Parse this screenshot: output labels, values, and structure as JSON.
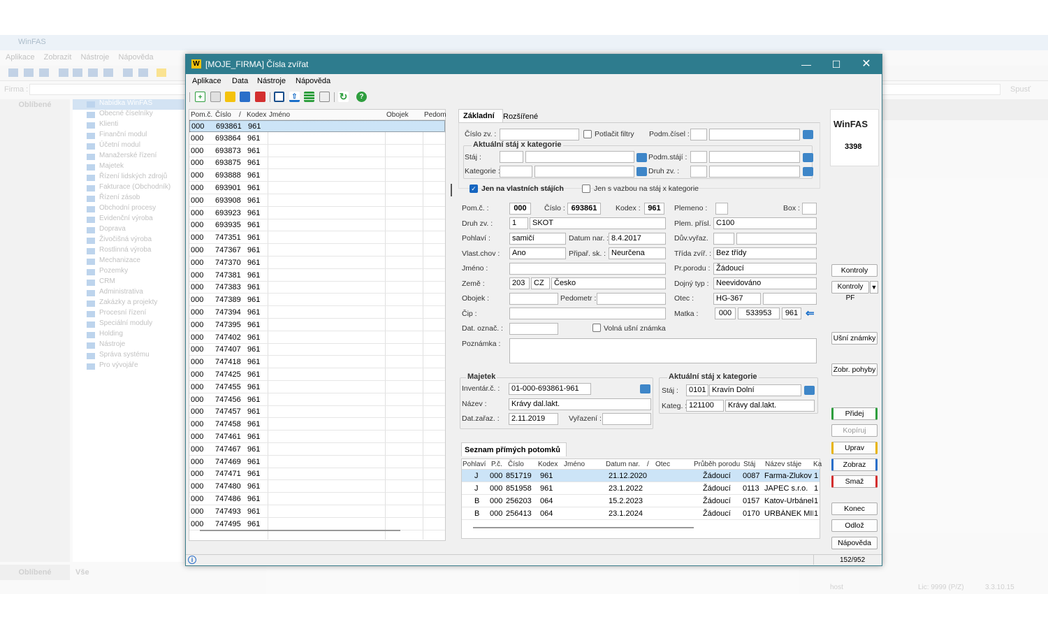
{
  "bg": {
    "title": "WinFAS",
    "menu": [
      "Aplikace",
      "Zobrazit",
      "Nástroje",
      "Nápověda"
    ],
    "firma_label": "Firma :",
    "left_header": "Oblíbené",
    "tree": [
      "Nabídka WinFAS",
      "Obecné číselníky",
      "Klienti",
      "Finanční modul",
      "Účetní modul",
      "Manažerské řízení",
      "Majetek",
      "Řízení lidských zdrojů",
      "Fakturace (Obchodník)",
      "Řízení zásob",
      "Obchodní procesy",
      "Evidenční výroba",
      "Doprava",
      "Živočišná výroba",
      "Rostlinná výroba",
      "Mechanizace",
      "Pozemky",
      "CRM",
      "Administrativa",
      "Zakázky a projekty",
      "Procesní řízení",
      "Speciální moduly",
      "Holding",
      "Nástroje",
      "Správa systému",
      "Pro vývojáře"
    ],
    "spust": "Spusť",
    "bottom_left": "Oblíbené",
    "bottom_all": "Vše",
    "status_host": "host",
    "status_lic": "Lic: 9999 (P/Z)",
    "status_ver": "3.3.10.15"
  },
  "window": {
    "title": "[MOJE_FIRMA] Čísla zvířat",
    "menu": [
      "Aplikace",
      "Data",
      "Nástroje",
      "Nápověda"
    ],
    "status_count": "152/952"
  },
  "list": {
    "headers": [
      "Pom.č.",
      "Číslo",
      "/",
      "Kodex",
      "Jméno",
      "Obojek",
      "Pedom"
    ],
    "rows": [
      [
        "000",
        "693861",
        "961"
      ],
      [
        "000",
        "693864",
        "961"
      ],
      [
        "000",
        "693873",
        "961"
      ],
      [
        "000",
        "693875",
        "961"
      ],
      [
        "000",
        "693888",
        "961"
      ],
      [
        "000",
        "693901",
        "961"
      ],
      [
        "000",
        "693908",
        "961"
      ],
      [
        "000",
        "693923",
        "961"
      ],
      [
        "000",
        "693935",
        "961"
      ],
      [
        "000",
        "747351",
        "961"
      ],
      [
        "000",
        "747367",
        "961"
      ],
      [
        "000",
        "747370",
        "961"
      ],
      [
        "000",
        "747381",
        "961"
      ],
      [
        "000",
        "747383",
        "961"
      ],
      [
        "000",
        "747389",
        "961"
      ],
      [
        "000",
        "747394",
        "961"
      ],
      [
        "000",
        "747395",
        "961"
      ],
      [
        "000",
        "747402",
        "961"
      ],
      [
        "000",
        "747407",
        "961"
      ],
      [
        "000",
        "747418",
        "961"
      ],
      [
        "000",
        "747425",
        "961"
      ],
      [
        "000",
        "747455",
        "961"
      ],
      [
        "000",
        "747456",
        "961"
      ],
      [
        "000",
        "747457",
        "961"
      ],
      [
        "000",
        "747458",
        "961"
      ],
      [
        "000",
        "747461",
        "961"
      ],
      [
        "000",
        "747467",
        "961"
      ],
      [
        "000",
        "747469",
        "961"
      ],
      [
        "000",
        "747471",
        "961"
      ],
      [
        "000",
        "747480",
        "961"
      ],
      [
        "000",
        "747486",
        "961"
      ],
      [
        "000",
        "747493",
        "961"
      ],
      [
        "000",
        "747495",
        "961"
      ]
    ]
  },
  "tabs": [
    "Základní",
    "Rozšířené"
  ],
  "filter": {
    "cislo_zv": "Číslo zv. :",
    "potlacit": "Potlačit filtry",
    "podm_cisel": "Podm.čísel :",
    "group_title": "Aktuální stáj x kategorie",
    "staj": "Stáj :",
    "podm_staji": "Podm.stájí :",
    "kategorie": "Kategorie :",
    "druh_zv": "Druh zv. :",
    "jen_vlastni": "Jen na vlastních stájích",
    "jen_vazbou": "Jen s vazbou na stáj x kategorie"
  },
  "form": {
    "pomc_l": "Pom.č. :",
    "pomc": "000",
    "cislo_l": "Číslo :",
    "cislo": "693861",
    "kodex_l": "Kodex :",
    "kodex": "961",
    "plemeno_l": "Plemeno :",
    "box_l": "Box :",
    "druh_l": "Druh zv. :",
    "druh_code": "1",
    "druh": "SKOT",
    "plem_prisl_l": "Plem. přísl. :",
    "plem_prisl": "C100",
    "pohlavi_l": "Pohlaví :",
    "pohlavi": "samičí",
    "datum_nar_l": "Datum nar. :",
    "datum_nar": "8.4.2017",
    "duv_vyraz_l": "Dův.vyřaz.",
    "vlast_chov_l": "Vlast.chov :",
    "vlast_chov": "Ano",
    "pripar_l": "Připař. sk. :",
    "pripar": "Neurčena",
    "trida_l": "Třída zvíř. :",
    "trida": "Bez třídy",
    "jmeno_l": "Jméno :",
    "pr_porodu_l": "Pr.porodu :",
    "pr_porodu": "Žádoucí",
    "zeme_l": "Země :",
    "zeme_code": "203",
    "zeme_iso": "CZ",
    "zeme": "Česko",
    "dojny_l": "Dojný typ :",
    "dojny": "Neevidováno",
    "obojek_l": "Obojek :",
    "pedometr_l": "Pedometr :",
    "otec_l": "Otec :",
    "otec": "HG-367",
    "cip_l": "Čip :",
    "matka_l": "Matka :",
    "matka_pom": "000",
    "matka_cislo": "533953",
    "matka_kodex": "961",
    "dat_ozn_l": "Dat. označ. :",
    "volna_l": "Volná ušní známka",
    "poznamka_l": "Poznámka :"
  },
  "majetek": {
    "title": "Majetek",
    "inv_l": "Inventár.č. :",
    "inv": "01-000-693861-961",
    "nazev_l": "Název :",
    "nazev": "Krávy dal.lakt.",
    "zarazeni_l": "Dat.zařaz. :",
    "zarazeni": "2.11.2019",
    "vyrazeni_l": "Vyřazení :"
  },
  "aktualni": {
    "title": "Aktuální stáj x kategorie",
    "staj_l": "Stáj :",
    "staj_code": "0101",
    "staj": "Kravín Dolní",
    "kateg_l": "Kateg. :",
    "kateg_code": "121100",
    "kateg": "Krávy dal.lakt."
  },
  "potomci": {
    "title": "Seznam přímých potomků",
    "headers": [
      "Pohlaví",
      "P.č.",
      "Číslo",
      "Kodex",
      "Jméno",
      "Datum nar.",
      "/",
      "Otec",
      "Průběh porodu",
      "Stáj",
      "Název stáje",
      "Ka"
    ],
    "rows": [
      {
        "pohlavi": "J",
        "pc": "000",
        "cislo": "851719",
        "kodex": "961",
        "datum": "21.12.2020",
        "prubeh": "Žádoucí",
        "staj": "0087",
        "nazev": "Farma-Zlukov",
        "ka": "1"
      },
      {
        "pohlavi": "J",
        "pc": "000",
        "cislo": "851958",
        "kodex": "961",
        "datum": "23.1.2022",
        "prubeh": "Žádoucí",
        "staj": "0113",
        "nazev": "JAPEC s.r.o.",
        "ka": "1"
      },
      {
        "pohlavi": "B",
        "pc": "000",
        "cislo": "256203",
        "kodex": "064",
        "datum": "15.2.2023",
        "prubeh": "Žádoucí",
        "staj": "0157",
        "nazev": "Katov-Urbánek",
        "ka": "1"
      },
      {
        "pohlavi": "B",
        "pc": "000",
        "cislo": "256413",
        "kodex": "064",
        "datum": "23.1.2024",
        "prubeh": "Žádoucí",
        "staj": "0170",
        "nazev": "URBÁNEK MILAN",
        "ka": "1"
      }
    ]
  },
  "side": {
    "logo": "WinFAS",
    "number": "3398",
    "kontroly": "Kontroly",
    "kontroly_pf": "Kontroly PF",
    "usni": "Ušní známky",
    "zobr": "Zobr. pohyby",
    "pridej": "Přidej",
    "kopiruj": "Kopíruj",
    "uprav": "Uprav",
    "zobraz": "Zobraz",
    "smaz": "Smaž",
    "konec": "Konec",
    "odloz": "Odlož",
    "napoveda": "Nápověda"
  },
  "colors": {
    "titlebar": "#2e7c8e",
    "selection": "#cce4f7",
    "pridej": "#2e9e3e",
    "uprav": "#e8b400",
    "zobraz": "#2a6fc9",
    "smaz": "#d32f2f"
  }
}
